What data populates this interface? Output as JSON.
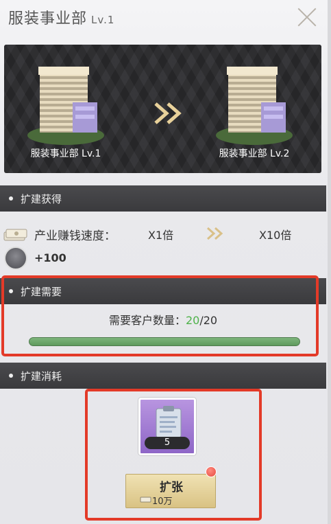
{
  "header": {
    "title": "服装事业部",
    "level": "Lv.1"
  },
  "banner": {
    "left_label": "服装事业部 Lv.1",
    "right_label": "服装事业部 Lv.2"
  },
  "gain": {
    "section_title": "扩建获得",
    "speed_label": "产业赚钱速度：",
    "speed_from": "X1倍",
    "speed_to": "X10倍",
    "bonus_value": "+100"
  },
  "requirement": {
    "section_title": "扩建需要",
    "label": "需要客户数量：",
    "current": "20",
    "separator": "/",
    "required": "20",
    "progress": 1.0
  },
  "cost": {
    "section_title": "扩建消耗",
    "item_count": "5",
    "button_label": "扩张",
    "button_cost": "10万"
  },
  "colors": {
    "accent_red": "#e33a28",
    "progress_green": "#4fb24a",
    "button_gold": "#d9c284"
  }
}
